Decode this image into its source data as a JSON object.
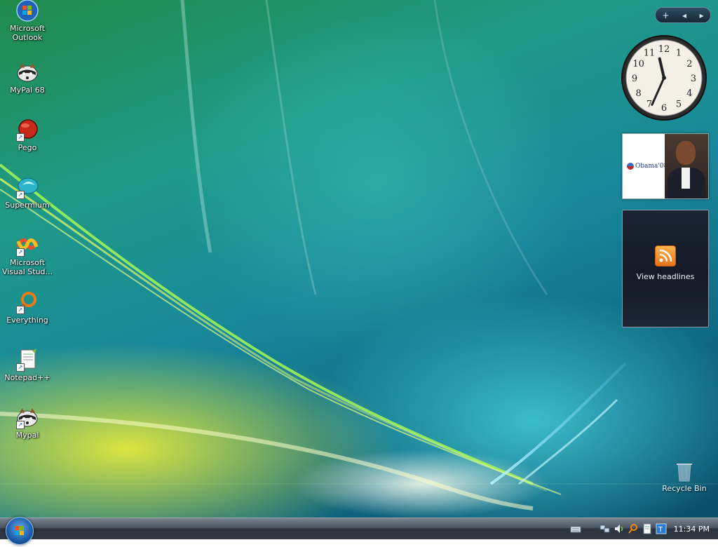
{
  "desktop": {
    "icons": [
      {
        "label": "Microsoft Outlook",
        "line1": "Microsoft",
        "line2": "Outlook",
        "icon": "windows-orb-icon"
      },
      {
        "label": "MyPal 68",
        "line1": "MyPal 68",
        "line2": "",
        "icon": "raccoon-icon"
      },
      {
        "label": "Pego",
        "line1": "Pego",
        "line2": "",
        "icon": "red-globe-icon"
      },
      {
        "label": "Supermium",
        "line1": "Supermium",
        "line2": "",
        "icon": "supermium-icon"
      },
      {
        "label": "Microsoft Visual Stud...",
        "line1": "Microsoft",
        "line2": "Visual Stud...",
        "icon": "visual-studio-icon"
      },
      {
        "label": "Everything",
        "line1": "Everything",
        "line2": "",
        "icon": "magnifier-icon"
      },
      {
        "label": "Notepad++",
        "line1": "Notepad++",
        "line2": "",
        "icon": "notepad-icon"
      },
      {
        "label": "Mypal",
        "line1": "Mypal",
        "line2": "",
        "icon": "raccoon-icon"
      }
    ],
    "recycle_bin": {
      "label": "Recycle Bin",
      "icon": "recycle-bin-icon"
    }
  },
  "sidebar": {
    "controls": {
      "add": "+",
      "prev": "◂",
      "next": "▸"
    },
    "clock": {
      "numbers": [
        "12",
        "1",
        "2",
        "3",
        "4",
        "5",
        "6",
        "7",
        "8",
        "9",
        "10",
        "11"
      ],
      "hour": 11,
      "minute": 34
    },
    "slideshow": {
      "logo_text": "Obama'08",
      "icon": "slideshow-photo"
    },
    "feed": {
      "label": "View headlines",
      "icon": "rss-icon"
    }
  },
  "taskbar": {
    "start_icon": "windows-start-icon",
    "tray_icons": [
      "keyboard-icon",
      "network-icon",
      "volume-icon",
      "search-icon",
      "notepad-icon",
      "translator-icon"
    ],
    "time": "11:34 PM"
  },
  "colors": {
    "taskbar_top": "#7a8490",
    "taskbar_bottom": "#2b333c",
    "rss_orange": "#f08a24",
    "desktop_teal": "#19889a"
  }
}
